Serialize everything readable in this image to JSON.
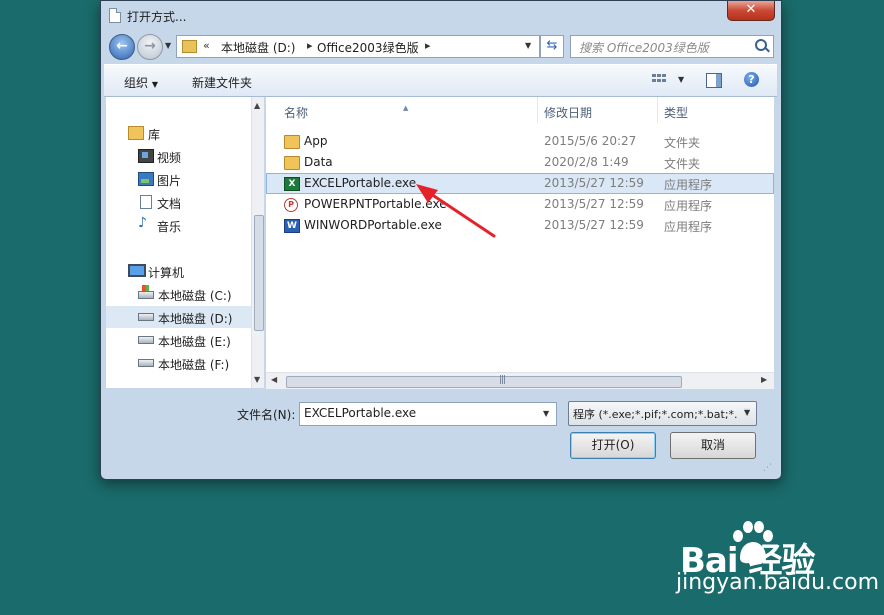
{
  "window": {
    "title": "打开方式...",
    "close": "✕"
  },
  "address": {
    "chevrons": "«",
    "sep": "▸",
    "parts": [
      "本地磁盘 (D:)",
      "Office2003绿色版"
    ]
  },
  "search": {
    "placeholder": "搜索 Office2003绿色版"
  },
  "toolbar": {
    "organize": "组织",
    "new_folder": "新建文件夹",
    "help": "?"
  },
  "nav": {
    "items": [
      {
        "label": "库",
        "icon": "library-icon"
      },
      {
        "label": "视频",
        "icon": "video-icon"
      },
      {
        "label": "图片",
        "icon": "picture-icon"
      },
      {
        "label": "文档",
        "icon": "document-icon"
      },
      {
        "label": "音乐",
        "icon": "music-icon"
      },
      {
        "label": "计算机",
        "icon": "computer-icon"
      },
      {
        "label": "本地磁盘 (C:)",
        "icon": "drive-icon"
      },
      {
        "label": "本地磁盘 (D:)",
        "icon": "drive-icon",
        "selected": true
      },
      {
        "label": "本地磁盘 (E:)",
        "icon": "drive-icon"
      },
      {
        "label": "本地磁盘 (F:)",
        "icon": "drive-icon"
      }
    ]
  },
  "columns": {
    "name": "名称",
    "modified": "修改日期",
    "type": "类型"
  },
  "files": [
    {
      "name": "App",
      "date": "2015/5/6 20:27",
      "type": "文件夹",
      "icon": "folder-icon"
    },
    {
      "name": "Data",
      "date": "2020/2/8 1:49",
      "type": "文件夹",
      "icon": "folder-icon"
    },
    {
      "name": "EXCELPortable.exe",
      "date": "2013/5/27 12:59",
      "type": "应用程序",
      "icon": "excel-icon",
      "selected": true
    },
    {
      "name": "POWERPNTPortable.exe",
      "date": "2013/5/27 12:59",
      "type": "应用程序",
      "icon": "powerpoint-icon"
    },
    {
      "name": "WINWORDPortable.exe",
      "date": "2013/5/27 12:59",
      "type": "应用程序",
      "icon": "word-icon"
    }
  ],
  "bottom": {
    "filename_label": "文件名(N):",
    "filename_value": "EXCELPortable.exe",
    "filter_value": "程序 (*.exe;*.pif;*.com;*.bat;*.",
    "open": "打开(O)",
    "cancel": "取消"
  },
  "watermark": {
    "logo": "Bai  经验",
    "sub": "jingyan.baidu.com"
  },
  "colors": {
    "desktop": "#1a6b6b",
    "frame": "#c6d7ea",
    "selection": "#d9e7f6",
    "annotation_arrow": "#e5222b"
  }
}
